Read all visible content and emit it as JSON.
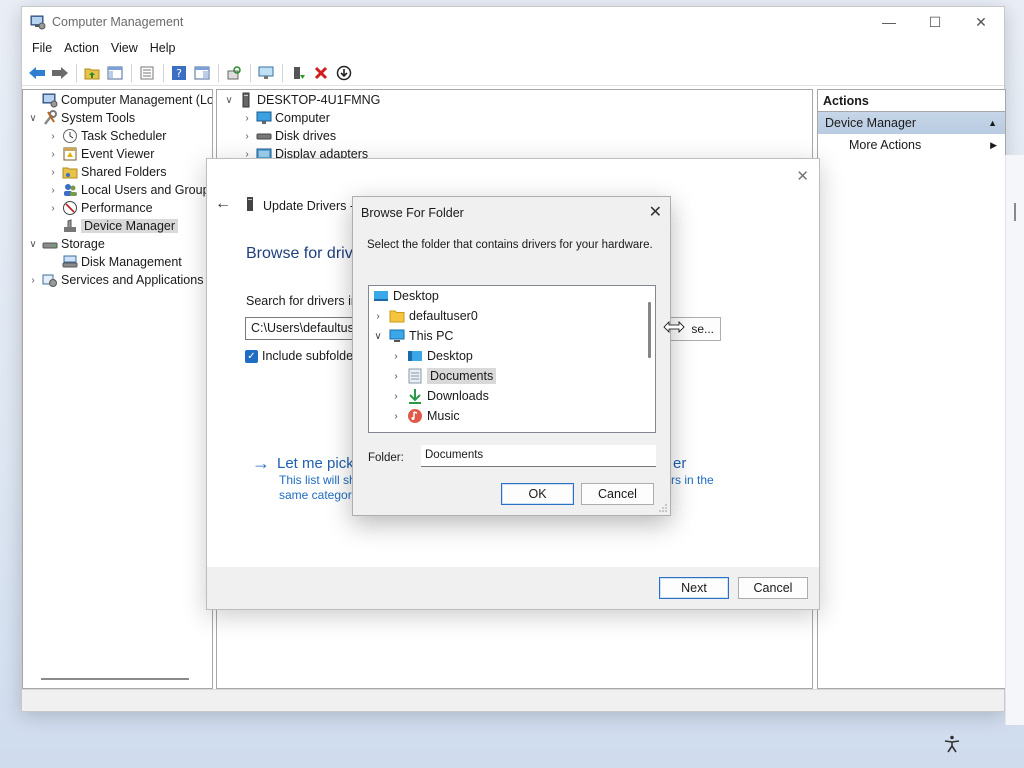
{
  "window": {
    "title": "Computer Management",
    "controls": {
      "minimize": "—",
      "maximize": "☐",
      "close": "✕"
    }
  },
  "menu": [
    "File",
    "Action",
    "View",
    "Help"
  ],
  "tree": {
    "root": "Computer Management (Local",
    "system_tools": "System Tools",
    "task_scheduler": "Task Scheduler",
    "event_viewer": "Event Viewer",
    "shared_folders": "Shared Folders",
    "local_users": "Local Users and Groups",
    "performance": "Performance",
    "device_manager": "Device Manager",
    "storage": "Storage",
    "disk_management": "Disk Management",
    "services": "Services and Applications"
  },
  "devices": {
    "computer_name": "DESKTOP-4U1FMNG",
    "items": [
      "Computer",
      "Disk drives",
      "Display adapters"
    ]
  },
  "actions": {
    "header": "Actions",
    "section": "Device Manager",
    "more": "More Actions"
  },
  "wizard": {
    "title": "Update Drivers -",
    "heading": "Browse for drive",
    "search_label": "Search for drivers in t",
    "path_value": "C:\\Users\\defaultuser",
    "browse_label": "se...",
    "include_subfolders": "Include subfolder",
    "link_text": "Let me pick",
    "link_text_right": "er",
    "desc_line1": "This list will sh",
    "desc_line2": "same category",
    "desc_right": "rs in the",
    "next": "Next",
    "cancel": "Cancel"
  },
  "browse_dialog": {
    "title": "Browse For Folder",
    "instruction": "Select the folder that contains drivers for your hardware.",
    "tree": {
      "desktop_root": "Desktop",
      "defaultuser": "defaultuser0",
      "this_pc": "This PC",
      "desktop": "Desktop",
      "documents": "Documents",
      "downloads": "Downloads",
      "music": "Music"
    },
    "folder_label": "Folder:",
    "folder_value": "Documents",
    "ok": "OK",
    "cancel": "Cancel"
  },
  "colors": {
    "accent": "#1f6dc2",
    "link": "#1f5fae",
    "selection": "#d9d9d9",
    "actions_section": "#c7d6e8"
  }
}
